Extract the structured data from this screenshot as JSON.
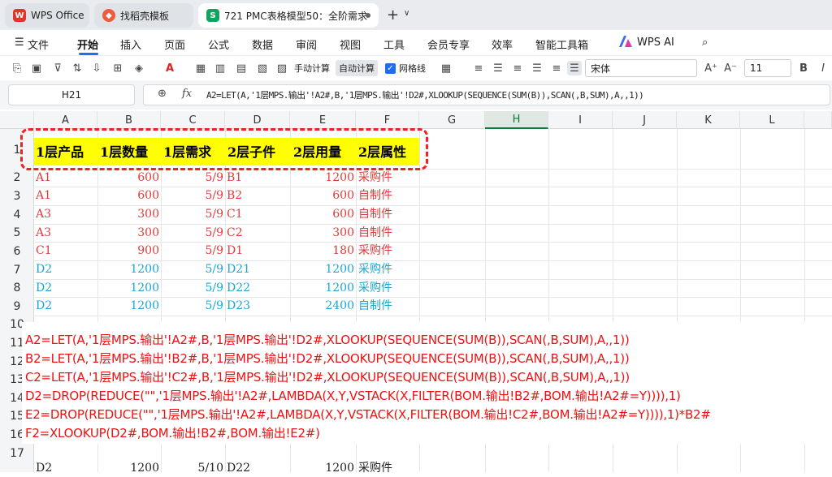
{
  "tabs": [
    {
      "label": "WPS Office",
      "icon": "wps-logo-icon"
    },
    {
      "label": "找稻壳模板",
      "icon": "template-icon"
    },
    {
      "label": "721 PMC表格模型50：全阶需求",
      "icon": "spreadsheet-icon"
    }
  ],
  "menu": [
    "文件",
    "开始",
    "插入",
    "页面",
    "公式",
    "数据",
    "审阅",
    "视图",
    "工具",
    "会员专享",
    "效率",
    "智能工具箱",
    "WPS AI"
  ],
  "toolbar": {
    "manual_calc": "手动计算",
    "auto_calc": "自动计算",
    "gridlines": "网格线",
    "font_name": "宋体",
    "font_size": "11"
  },
  "name_box": "H21",
  "fx_label": "fx",
  "formula": "A2=LET(A,'1层MPS.输出'!A2#,B,'1层MPS.输出'!D2#,XLOOKUP(SEQUENCE(SUM(B)),SCAN(,B,SUM),A,,1))",
  "columns": [
    "A",
    "B",
    "C",
    "D",
    "E",
    "F",
    "G",
    "H",
    "I",
    "J",
    "K",
    "L"
  ],
  "rows": [
    "1",
    "2",
    "3",
    "4",
    "5",
    "6",
    "7",
    "8",
    "9",
    "10",
    "11",
    "12",
    "13",
    "14",
    "15",
    "16",
    "17"
  ],
  "header_row": [
    "1层产品",
    "1层数量",
    "1层需求",
    "2层子件",
    "2层用量",
    "2层属性"
  ],
  "data_rows": [
    {
      "a": "A1",
      "b": "600",
      "c": "5/9",
      "d": "B1",
      "e": "1200",
      "f": "采购件"
    },
    {
      "a": "A1",
      "b": "600",
      "c": "5/9",
      "d": "B2",
      "e": "600",
      "f": "自制件"
    },
    {
      "a": "A3",
      "b": "300",
      "c": "5/9",
      "d": "C1",
      "e": "600",
      "f": "自制件"
    },
    {
      "a": "A3",
      "b": "300",
      "c": "5/9",
      "d": "C2",
      "e": "300",
      "f": "自制件"
    },
    {
      "a": "C1",
      "b": "900",
      "c": "5/9",
      "d": "D1",
      "e": "180",
      "f": "采购件"
    },
    {
      "a": "D2",
      "b": "1200",
      "c": "5/9",
      "d": "D21",
      "e": "1200",
      "f": "采购件"
    },
    {
      "a": "D2",
      "b": "1200",
      "c": "5/9",
      "d": "D22",
      "e": "1200",
      "f": "采购件"
    },
    {
      "a": "D2",
      "b": "1200",
      "c": "5/9",
      "d": "D23",
      "e": "2400",
      "f": "自制件"
    }
  ],
  "bottom_row": {
    "a": "D2",
    "b": "1200",
    "c": "5/10",
    "d": "D22",
    "e": "1200",
    "f": "采购件"
  },
  "formula_overlay": [
    "A2=LET(A,'1层MPS.输出'!A2#,B,'1层MPS.输出'!D2#,XLOOKUP(SEQUENCE(SUM(B)),SCAN(,B,SUM),A,,1))",
    "B2=LET(A,'1层MPS.输出'!B2#,B,'1层MPS.输出'!D2#,XLOOKUP(SEQUENCE(SUM(B)),SCAN(,B,SUM),A,,1))",
    "C2=LET(A,'1层MPS.输出'!C2#,B,'1层MPS.输出'!D2#,XLOOKUP(SEQUENCE(SUM(B)),SCAN(,B,SUM),A,,1))",
    "D2=DROP(REDUCE(\"\",'1层MPS.输出'!A2#,LAMBDA(X,Y,VSTACK(X,FILTER(BOM.输出!B2#,BOM.输出!A2#=Y)))),1)",
    "E2=DROP(REDUCE(\"\",'1层MPS.输出'!A2#,LAMBDA(X,Y,VSTACK(X,FILTER(BOM.输出!C2#,BOM.输出!A2#=Y)))),1)*B2#",
    "F2=XLOOKUP(D2#,BOM.输出!B2#,BOM.输出!E2#)"
  ],
  "colors": {
    "red_text": "#e23b3b",
    "blue_text": "#1aa7d4",
    "highlight": "#ffff00",
    "overlay_text": "#ee1111",
    "accent": "#1d6df5"
  }
}
